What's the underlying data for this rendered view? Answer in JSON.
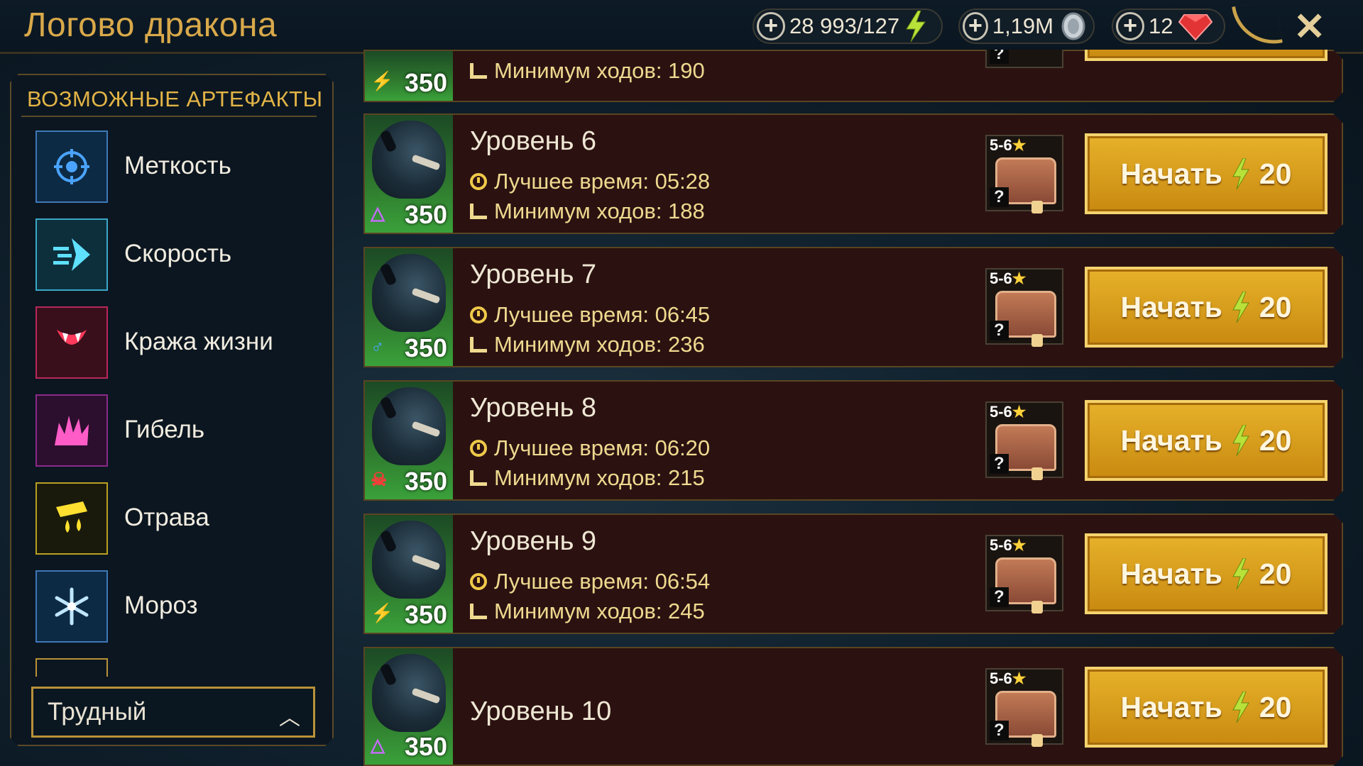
{
  "header": {
    "title": "Логово дракона",
    "energy": "28 993/127",
    "silver": "1,19M",
    "gems": "12"
  },
  "sidebar": {
    "heading": "ВОЗМОЖНЫЕ АРТЕФАКТЫ",
    "items": [
      {
        "label": "Меткость",
        "icon": "accuracy-icon"
      },
      {
        "label": "Скорость",
        "icon": "speed-icon"
      },
      {
        "label": "Кража жизни",
        "icon": "lifesteal-icon"
      },
      {
        "label": "Гибель",
        "icon": "destroy-icon"
      },
      {
        "label": "Отрава",
        "icon": "toxic-icon"
      },
      {
        "label": "Мороз",
        "icon": "frost-icon"
      }
    ],
    "difficulty": "Трудный"
  },
  "levels": [
    {
      "name": "",
      "best_time": "",
      "min_turns": "Минимум ходов: 190",
      "power": "350",
      "affinity": "force",
      "rewards": "5-6"
    },
    {
      "name": "Уровень 6",
      "best_time": "Лучшее время: 05:28",
      "min_turns": "Минимум ходов: 188",
      "power": "350",
      "affinity": "void",
      "rewards": "5-6"
    },
    {
      "name": "Уровень 7",
      "best_time": "Лучшее время: 06:45",
      "min_turns": "Минимум ходов: 236",
      "power": "350",
      "affinity": "magic",
      "rewards": "5-6"
    },
    {
      "name": "Уровень 8",
      "best_time": "Лучшее время: 06:20",
      "min_turns": "Минимум ходов: 215",
      "power": "350",
      "affinity": "spirit",
      "rewards": "5-6"
    },
    {
      "name": "Уровень 9",
      "best_time": "Лучшее время: 06:54",
      "min_turns": "Минимум ходов: 245",
      "power": "350",
      "affinity": "force",
      "rewards": "5-6"
    },
    {
      "name": "Уровень 10",
      "best_time": "",
      "min_turns": "",
      "power": "350",
      "affinity": "void",
      "rewards": "5-6"
    }
  ],
  "start_button": {
    "label": "Начать",
    "cost": "20"
  },
  "colors": {
    "accent": "#e2b446",
    "button": "#d99a1a",
    "row_bg": "#2b1211"
  }
}
